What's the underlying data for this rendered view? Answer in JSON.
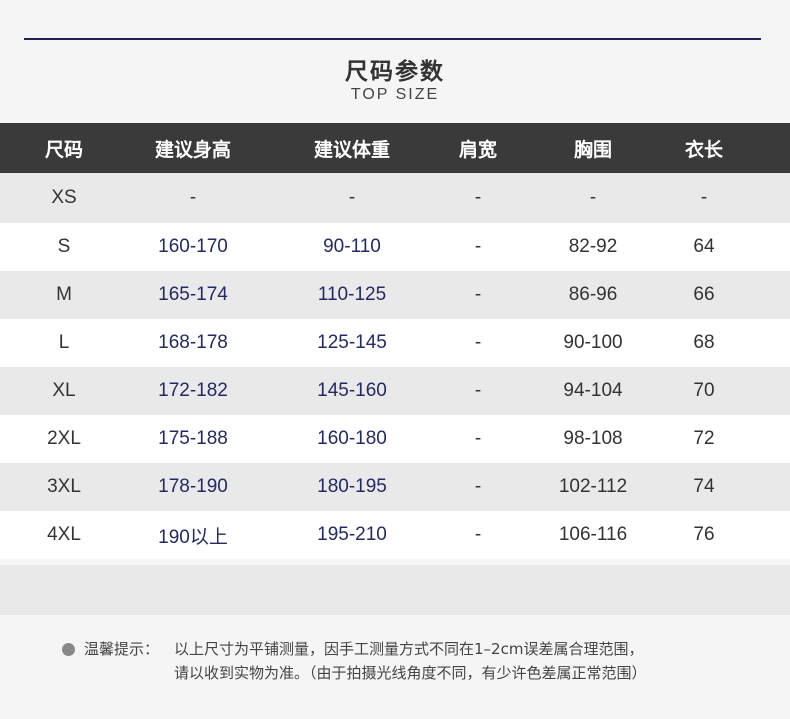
{
  "header": {
    "title_cn": "尺码参数",
    "title_en": "TOP SIZE"
  },
  "table": {
    "columns": [
      "尺码",
      "建议身高",
      "建议体重",
      "肩宽",
      "胸围",
      "衣长"
    ],
    "rows": [
      [
        "XS",
        "-",
        "-",
        "-",
        "-",
        "-"
      ],
      [
        "S",
        "160-170",
        "90-110",
        "-",
        "82-92",
        "64"
      ],
      [
        "M",
        "165-174",
        "110-125",
        "-",
        "86-96",
        "66"
      ],
      [
        "L",
        "168-178",
        "125-145",
        "-",
        "90-100",
        "68"
      ],
      [
        "XL",
        "172-182",
        "145-160",
        "-",
        "94-104",
        "70"
      ],
      [
        "2XL",
        "175-188",
        "160-180",
        "-",
        "98-108",
        "72"
      ],
      [
        "3XL",
        "178-190",
        "180-195",
        "-",
        "102-112",
        "74"
      ],
      [
        "4XL",
        "190以上",
        "195-210",
        "-",
        "106-116",
        "76"
      ]
    ]
  },
  "note": {
    "label": "温馨提示：",
    "line1": "以上尺寸为平铺测量，因手工测量方式不同在1–2cm误差属合理范围，",
    "line2": "请以收到实物为准。（由于拍摄光线角度不同，有少许色差属正常范围）"
  },
  "colors": {
    "header_bg": "#3a3a3a",
    "accent_line": "#1f2450",
    "value_blue": "#232a63"
  }
}
